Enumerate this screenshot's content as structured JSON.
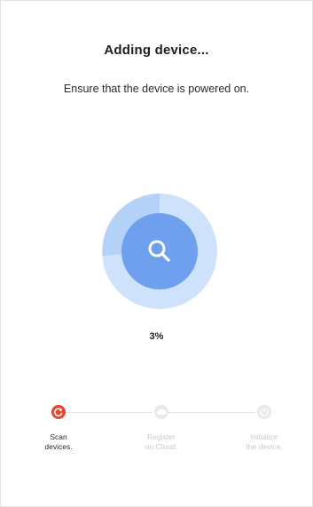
{
  "header": {
    "title": "Adding device...",
    "instruction": "Ensure that the device is powered on."
  },
  "progress": {
    "percent_label": "3%",
    "value_fraction": 0.03,
    "icon": "search-icon"
  },
  "steps": [
    {
      "line1": "Scan",
      "line2": "devices.",
      "state": "active",
      "icon": "refresh-icon"
    },
    {
      "line1": "Register",
      "line2": "on Cloud.",
      "state": "pending",
      "icon": "cloud-icon"
    },
    {
      "line1": "Initialize",
      "line2": "the device.",
      "state": "pending",
      "icon": "power-icon"
    }
  ],
  "colors": {
    "outer_ring": "#cfe2fb",
    "outer_ring_sweep": "#b4d1f8",
    "inner_circle": "#6fa0ef",
    "active_step": "#e8442e",
    "inactive_step": "#e9e9e9",
    "track": "#e4e4e4"
  }
}
